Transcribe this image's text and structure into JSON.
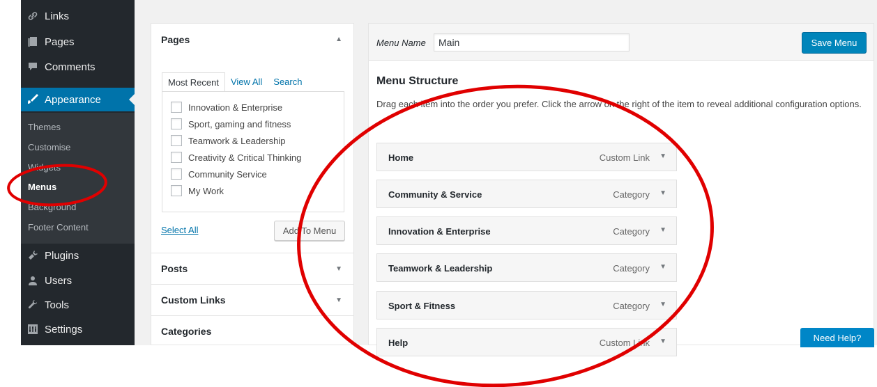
{
  "sidebar": {
    "items_top": [
      {
        "label": "Links",
        "icon": "link-icon"
      },
      {
        "label": "Pages",
        "icon": "pages-icon"
      },
      {
        "label": "Comments",
        "icon": "comments-icon"
      }
    ],
    "active": {
      "label": "Appearance",
      "icon": "appearance-brush-icon"
    },
    "submenu": [
      "Themes",
      "Customise",
      "Widgets",
      "Menus",
      "Background",
      "Footer Content"
    ],
    "items_bottom": [
      {
        "label": "Plugins",
        "icon": "plugins-icon"
      },
      {
        "label": "Users",
        "icon": "users-icon"
      },
      {
        "label": "Tools",
        "icon": "tools-icon"
      },
      {
        "label": "Settings",
        "icon": "settings-icon"
      }
    ]
  },
  "left_panel": {
    "pages_title": "Pages",
    "tabs": [
      "Most Recent",
      "View All",
      "Search"
    ],
    "pages": [
      "Innovation & Enterprise",
      "Sport, gaming and fitness",
      "Teamwork & Leadership",
      "Creativity & Critical Thinking",
      "Community Service",
      "My Work"
    ],
    "select_all": "Select All",
    "add_to_menu": "Add To Menu",
    "sections": [
      "Posts",
      "Custom Links",
      "Categories"
    ]
  },
  "editor": {
    "menu_name_label": "Menu Name",
    "menu_name_value": "Main",
    "save_button": "Save Menu",
    "structure_title": "Menu Structure",
    "structure_desc": "Drag each item into the order you prefer. Click the arrow on the right of the item to reveal additional configuration options.",
    "items": [
      {
        "title": "Home",
        "type": "Custom Link"
      },
      {
        "title": "Community & Service",
        "type": "Category"
      },
      {
        "title": "Innovation & Enterprise",
        "type": "Category"
      },
      {
        "title": "Teamwork & Leadership",
        "type": "Category"
      },
      {
        "title": "Sport & Fitness",
        "type": "Category"
      },
      {
        "title": "Help",
        "type": "Custom Link"
      }
    ]
  },
  "need_help": "Need Help?",
  "colors": {
    "sidebar": "#23282d",
    "active": "#0073aa",
    "button": "#0085ba",
    "annotation": "#e00000"
  }
}
